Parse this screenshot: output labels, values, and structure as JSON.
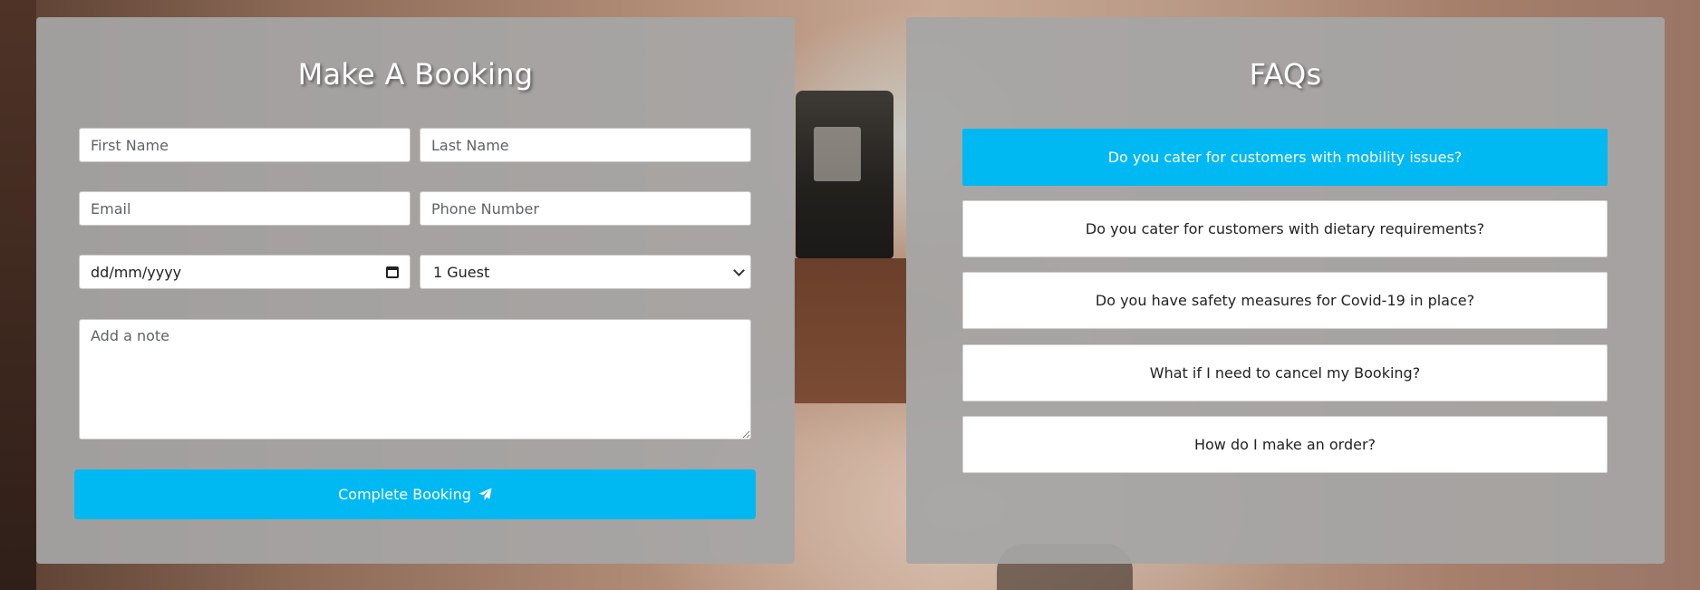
{
  "booking": {
    "title": "Make A Booking",
    "first_name": {
      "placeholder": "First Name",
      "value": ""
    },
    "last_name": {
      "placeholder": "Last Name",
      "value": ""
    },
    "email": {
      "placeholder": "Email",
      "value": ""
    },
    "phone": {
      "placeholder": "Phone Number",
      "value": ""
    },
    "date": {
      "display": "dd/mm/yyyy",
      "icon": "calendar-icon"
    },
    "guests": {
      "selected": "1 Guest"
    },
    "note": {
      "placeholder": "Add a note",
      "value": ""
    },
    "submit": {
      "label": "Complete Booking",
      "icon": "paper-plane-icon"
    }
  },
  "faqs": {
    "title": "FAQs",
    "items": [
      {
        "question": "Do you cater for customers with mobility issues?",
        "active": true
      },
      {
        "question": "Do you cater for customers with dietary requirements?",
        "active": false
      },
      {
        "question": "Do you have safety measures for Covid-19 in place?",
        "active": false
      },
      {
        "question": "What if I need to cancel my Booking?",
        "active": false
      },
      {
        "question": "How do I make an order?",
        "active": false
      }
    ]
  },
  "colors": {
    "accent": "#00b9f2",
    "panel": "#a6a6a6",
    "heading_text": "#ffffff"
  }
}
